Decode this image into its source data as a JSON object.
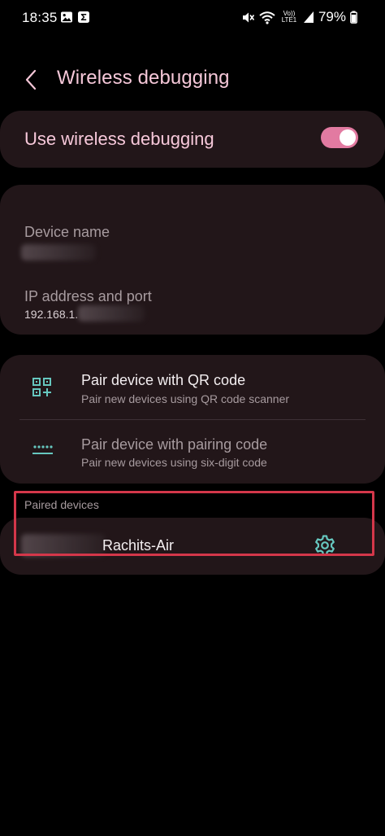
{
  "status_bar": {
    "time": "18:35",
    "battery_percent": "79%",
    "network_label": "Vo)) LTE1",
    "left_icons": [
      "image-icon",
      "sigma-icon"
    ],
    "right_icons": [
      "mute-icon",
      "wifi-icon",
      "signal-icon",
      "battery-icon"
    ]
  },
  "header": {
    "title": "Wireless debugging",
    "back_icon": "chevron-left-icon"
  },
  "toggle_card": {
    "label": "Use wireless debugging",
    "enabled": true,
    "toggle_color": "#e27aa1"
  },
  "info_card": {
    "device_name_label": "Device name",
    "device_name_value": "",
    "ip_label": "IP address and port",
    "ip_value": "192.168.1."
  },
  "pair_card": {
    "qr": {
      "title": "Pair device with QR code",
      "subtitle": "Pair new devices using QR code scanner",
      "icon": "qr-code-add-icon"
    },
    "code": {
      "title": "Pair device with pairing code",
      "subtitle": "Pair new devices using six-digit code",
      "icon": "password-dots-icon"
    }
  },
  "paired_devices": {
    "header": "Paired devices",
    "items": [
      {
        "name": "Rachits-Air",
        "icon": "gear-icon"
      }
    ]
  },
  "colors": {
    "background": "#000000",
    "card": "#221619",
    "title_pink": "#f5c7d8",
    "accent_teal": "#66c7bf",
    "highlight_red": "#d4374a"
  }
}
